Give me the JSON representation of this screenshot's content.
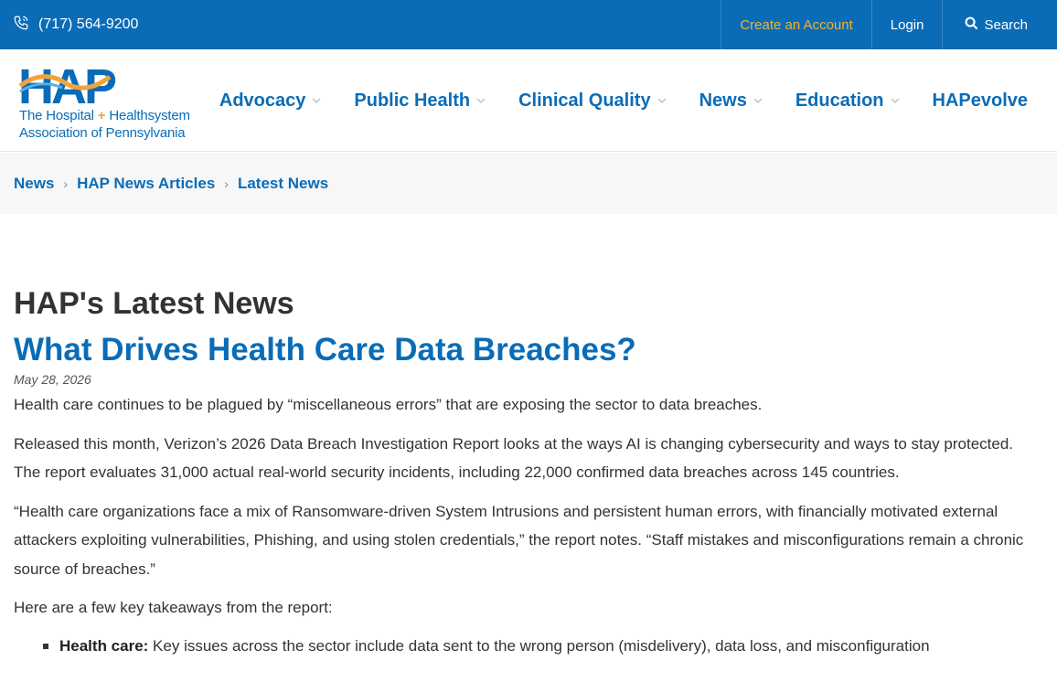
{
  "topbar": {
    "phone_icon": "phone-icon",
    "phone": "(717) 564-9200",
    "create_account": "Create an Account",
    "login": "Login",
    "search": "Search",
    "search_icon": "search-icon",
    "accent": "#0a6cb7",
    "create_color": "#f2b233"
  },
  "logo": {
    "mark": "HAP",
    "line1_a": "The Hospital",
    "line1_plus": "+",
    "line1_b": "Healthsystem",
    "line2": "Association of Pennsylvania"
  },
  "nav": {
    "items": [
      {
        "label": "Advocacy",
        "has_dropdown": true
      },
      {
        "label": "Public Health",
        "has_dropdown": true
      },
      {
        "label": "Clinical Quality",
        "has_dropdown": true
      },
      {
        "label": "News",
        "has_dropdown": true
      },
      {
        "label": "Education",
        "has_dropdown": true
      },
      {
        "label": "HAPevolve",
        "has_dropdown": false
      }
    ]
  },
  "breadcrumb": {
    "items": [
      "News",
      "HAP News Articles",
      "Latest News"
    ],
    "separator": "›"
  },
  "main": {
    "page_title": "HAP's Latest News",
    "article_title": "What Drives Health Care Data Breaches?",
    "date": "May 28, 2026",
    "paragraphs": [
      "Health care continues to be plagued by “miscellaneous errors” that are exposing the sector to data breaches.",
      "Released this month, Verizon’s 2026 Data Breach Investigation Report looks at the ways AI is changing cybersecurity and ways to stay protected. The report evaluates 31,000 actual real-world security incidents, including 22,000 confirmed data breaches across 145 countries.",
      "“Health care organizations face a mix of Ransomware-driven System Intrusions and persistent human errors, with financially motivated external attackers exploiting vulnerabilities, Phishing, and using stolen credentials,” the report notes. “Staff mistakes and misconfigurations remain a chronic source of breaches.”",
      "Here are a few key takeaways from the report:"
    ],
    "bullets": [
      {
        "bold": "Health care:",
        "text": " Key issues across the sector include data sent to the wrong person (misdelivery), data loss, and misconfiguration"
      }
    ]
  }
}
